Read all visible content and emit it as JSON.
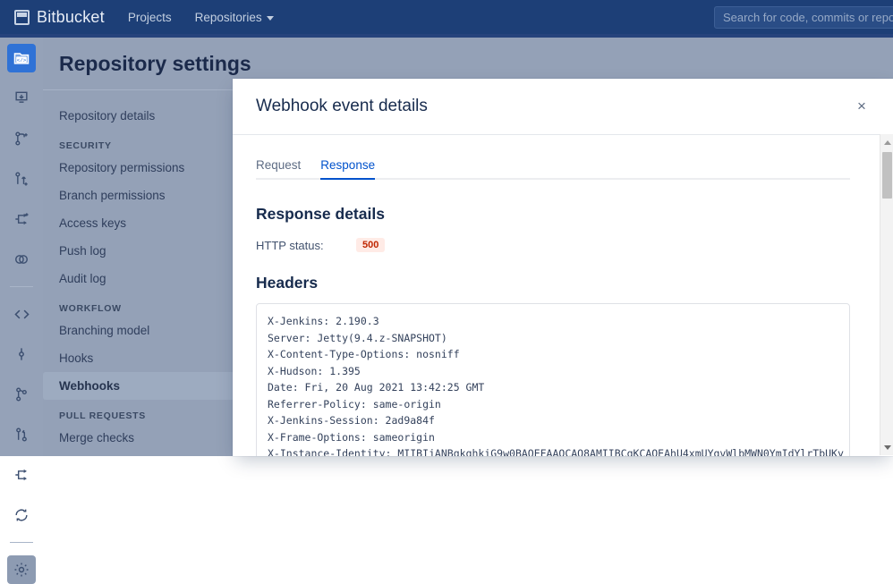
{
  "topbar": {
    "brand": "Bitbucket",
    "nav": [
      {
        "label": "Projects",
        "has_caret": false
      },
      {
        "label": "Repositories",
        "has_caret": true
      }
    ],
    "search_placeholder": "Search for code, commits or repos",
    "bg_color": "#1d3f77"
  },
  "rail": {
    "icons": [
      {
        "name": "repository-icon",
        "active": true
      },
      {
        "name": "clone-icon",
        "active": false
      },
      {
        "name": "create-branch-icon",
        "active": false
      },
      {
        "name": "create-pull-request-icon",
        "active": false
      },
      {
        "name": "create-fork-icon",
        "active": false
      },
      {
        "name": "compare-icon",
        "active": false
      },
      {
        "name": "source-code-icon",
        "active": false
      },
      {
        "name": "commits-icon",
        "active": false
      },
      {
        "name": "branches-icon",
        "active": false
      },
      {
        "name": "pull-requests-icon",
        "active": false
      },
      {
        "name": "forks-icon",
        "active": false
      },
      {
        "name": "builds-icon",
        "active": false
      },
      {
        "name": "settings-gear-icon",
        "active": false
      }
    ]
  },
  "sidebar": {
    "title": "Repository settings",
    "items": [
      {
        "label": "Repository details",
        "type": "item",
        "selected": false
      },
      {
        "label": "SECURITY",
        "type": "heading"
      },
      {
        "label": "Repository permissions",
        "type": "item",
        "selected": false
      },
      {
        "label": "Branch permissions",
        "type": "item",
        "selected": false
      },
      {
        "label": "Access keys",
        "type": "item",
        "selected": false
      },
      {
        "label": "Push log",
        "type": "item",
        "selected": false
      },
      {
        "label": "Audit log",
        "type": "item",
        "selected": false
      },
      {
        "label": "WORKFLOW",
        "type": "heading"
      },
      {
        "label": "Branching model",
        "type": "item",
        "selected": false
      },
      {
        "label": "Hooks",
        "type": "item",
        "selected": false
      },
      {
        "label": "Webhooks",
        "type": "item",
        "selected": true
      },
      {
        "label": "PULL REQUESTS",
        "type": "heading"
      },
      {
        "label": "Merge checks",
        "type": "item",
        "selected": false
      }
    ]
  },
  "modal": {
    "title": "Webhook event details",
    "close_icon": "×",
    "tabs": [
      {
        "label": "Request",
        "active": false
      },
      {
        "label": "Response",
        "active": true
      }
    ],
    "response_details": {
      "section_title": "Response details",
      "status_label": "HTTP status:",
      "status_value": "500",
      "status_bg": "#ffebe6",
      "status_color": "#bf2600"
    },
    "headers": {
      "section_title": "Headers",
      "content": "X-Jenkins: 2.190.3\nServer: Jetty(9.4.z-SNAPSHOT)\nX-Content-Type-Options: nosniff\nX-Hudson: 1.395\nDate: Fri, 20 Aug 2021 13:42:25 GMT\nReferrer-Policy: same-origin\nX-Jenkins-Session: 2ad9a84f\nX-Frame-Options: sameorigin\nX-Instance-Identity: MIIBIjANBgkqhkiG9w0BAQEFAAOCAQ8AMIIBCgKCAQEAhU4xmUYgvWlbMWN0YmIdYlrTbUKy"
    },
    "accent_color": "#0052cc"
  }
}
